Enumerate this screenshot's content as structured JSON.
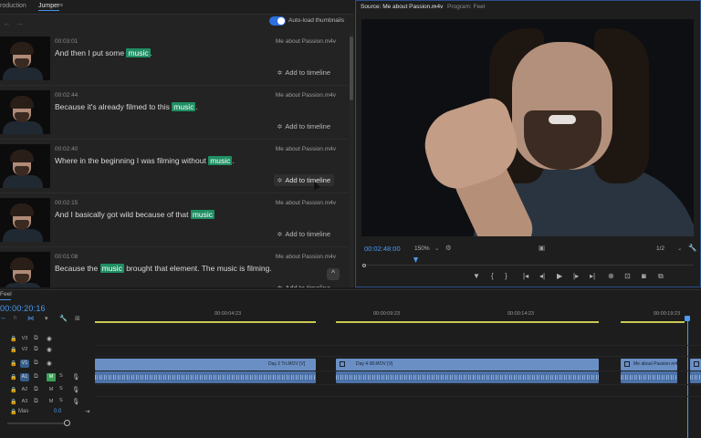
{
  "left_panel": {
    "tabs": [
      {
        "label": "roduction",
        "active": false
      },
      {
        "label": "Jumper",
        "active": true
      }
    ],
    "tab_menu_icon": "≡",
    "auto_load_label": "Auto-load thumbnails",
    "auto_load_on": true
  },
  "results": [
    {
      "timecode": "00:03:01",
      "clip": "Me about Passion.m4v",
      "before": "And then I put some ",
      "keyword": "music",
      "after": ".",
      "add_label": "Add to timeline",
      "hover": false
    },
    {
      "timecode": "00:02:44",
      "clip": "Me about Passion.m4v",
      "before": "Because it's already filmed to this ",
      "keyword": "music",
      "after": ".",
      "add_label": "Add to timeline",
      "hover": false
    },
    {
      "timecode": "00:02:40",
      "clip": "Me about Passion.m4v",
      "before": "Where in the beginning I was filming without ",
      "keyword": "music",
      "after": ".",
      "add_label": "Add to timeline",
      "hover": true
    },
    {
      "timecode": "00:02:15",
      "clip": "Me about Passion.m4v",
      "before": "And I basically got wild because of that ",
      "keyword": "music",
      "after": "",
      "add_label": "Add to timeline",
      "hover": false
    },
    {
      "timecode": "00:01:08",
      "clip": "Me about Passion.m4v",
      "before": "Because the ",
      "keyword": "music",
      "after": " brought that element. The music is filming.",
      "add_label": "Add to timeline",
      "hover": false
    }
  ],
  "monitor": {
    "source_tab": "Source: Me about Passion.m4v",
    "program_tab": "Program: Feel",
    "tab_menu_icon": "≡",
    "timecode": "00:02:48:00",
    "zoom": "150%",
    "ratio": "1/2",
    "controls": [
      "▼",
      "{",
      "}",
      "|◂",
      "◂|",
      "▶",
      "|▸",
      "▸|",
      "⊕",
      "⊡",
      "◙",
      "⧉"
    ]
  },
  "timeline": {
    "sequence_name": "Feel",
    "timecode": "00:00:20:16",
    "tools": [
      "↔",
      "∩",
      "⋈",
      "▾",
      "🔧",
      "⊞"
    ],
    "ruler_ticks": [
      "00:00:04:23",
      "00:00:09:23",
      "00:00:14:23",
      "00:00:19:23"
    ],
    "tracks": [
      {
        "label": "V3",
        "kind": "video"
      },
      {
        "label": "V2",
        "kind": "video"
      },
      {
        "label": "V1",
        "kind": "video",
        "targeted": true
      },
      {
        "label": "A1",
        "kind": "audio",
        "targeted": true,
        "mute": "M",
        "solo": "S",
        "green": true
      },
      {
        "label": "A2",
        "kind": "audio",
        "mute": "M",
        "solo": "S"
      },
      {
        "label": "A3",
        "kind": "audio",
        "mute": "M",
        "solo": "S"
      }
    ],
    "master_label": "Mas",
    "master_value": "0.0",
    "video_clips": [
      {
        "label": "Day 2 Tri.MOV [V]"
      },
      {
        "label": "Day 4 08.MOV [V]"
      },
      {
        "label": "Me about Passion.m4v"
      }
    ]
  },
  "colors": {
    "accent_blue": "#4a9cf0",
    "highlight_green": "#1f8f63",
    "video_clip": "#6a8fc4",
    "audio_clip": "#4c72a8"
  }
}
